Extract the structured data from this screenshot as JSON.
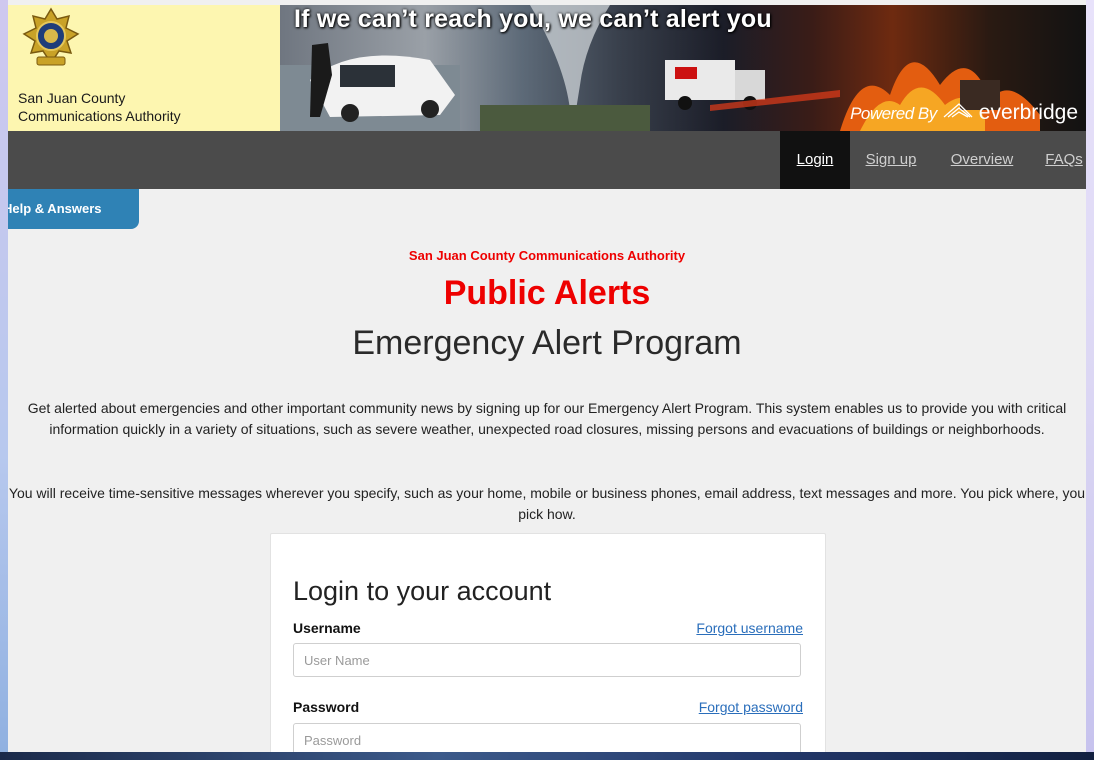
{
  "header": {
    "brand_line1": "San Juan County",
    "brand_line2": "Communications Authority",
    "banner_tagline": "If we can’t reach you, we can’t alert you",
    "powered_by": "Powered By",
    "powered_brand": "everbridge"
  },
  "nav": {
    "items": [
      {
        "label": "Login",
        "active": true
      },
      {
        "label": "Sign up",
        "active": false
      },
      {
        "label": "Overview",
        "active": false
      },
      {
        "label": "FAQs",
        "active": false
      }
    ]
  },
  "help_tab": {
    "label": "Help & Answers"
  },
  "main": {
    "org_name": "San Juan County Communications Authority",
    "title": "Public Alerts",
    "subtitle": "Emergency Alert Program",
    "intro": "Get alerted about emergencies and other important community news by signing up for our Emergency Alert Program. This system enables us to provide you with critical information quickly in a variety of situations, such as severe weather, unexpected road closures, missing persons and evacuations of buildings or neighborhoods.",
    "detail": "You will receive time-sensitive messages wherever you specify, such as your home, mobile or business phones, email address, text messages and more. You pick where, you pick how."
  },
  "login": {
    "heading": "Login to your account",
    "username_label": "Username",
    "forgot_username": "Forgot username",
    "username_placeholder": "User Name",
    "password_label": "Password",
    "forgot_password": "Forgot password",
    "password_placeholder": "Password"
  },
  "colors": {
    "accent_red": "#ee0000",
    "help_blue": "#2f82b5",
    "nav_bg": "#4b4b4b",
    "brand_bg": "#fdf6b0"
  }
}
